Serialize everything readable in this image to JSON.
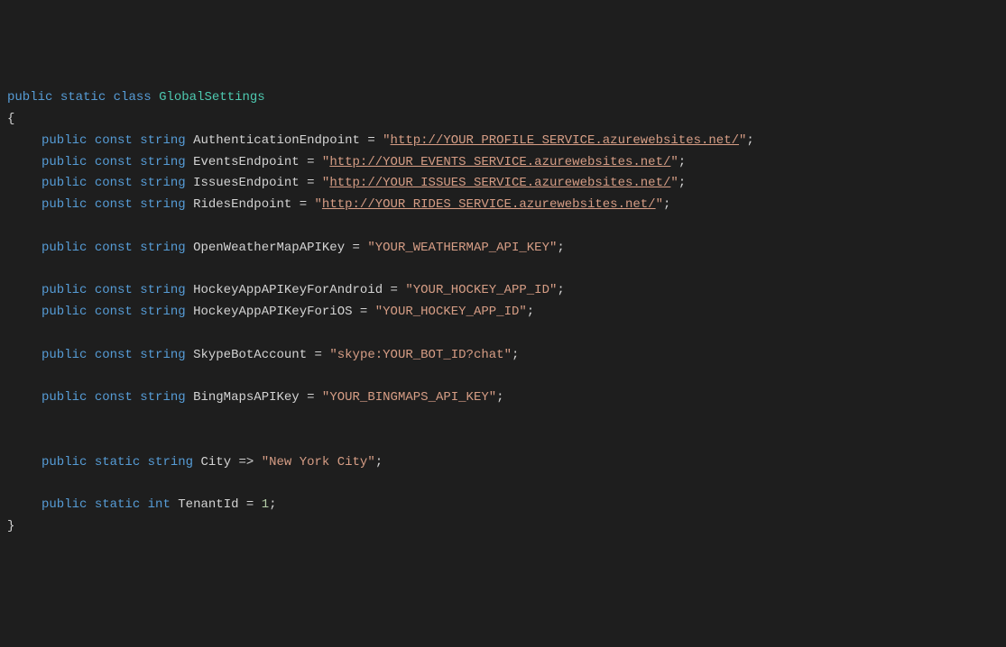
{
  "code": {
    "line0_public": "public",
    "line0_static": "static",
    "line0_class": "class",
    "line0_name": "GlobalSettings",
    "open_brace": "{",
    "close_brace": "}",
    "kw_public": "public",
    "kw_const": "const",
    "kw_static": "static",
    "kw_string": "string",
    "kw_int": "int",
    "eq": " = ",
    "arrow": " => ",
    "semi": ";",
    "quote": "\"",
    "auth_name": "AuthenticationEndpoint",
    "auth_url": "http://YOUR_PROFILE_SERVICE.azurewebsites.net/",
    "events_name": "EventsEndpoint",
    "events_url": "http://YOUR_EVENTS_SERVICE.azurewebsites.net/",
    "issues_name": "IssuesEndpoint",
    "issues_url": "http://YOUR_ISSUES_SERVICE.azurewebsites.net/",
    "rides_name": "RidesEndpoint",
    "rides_url": "http://YOUR_RIDES_SERVICE.azurewebsites.net/",
    "owm_name": "OpenWeatherMapAPIKey",
    "owm_val": "YOUR_WEATHERMAP_API_KEY",
    "hockey_android_name": "HockeyAppAPIKeyForAndroid",
    "hockey_android_val": "YOUR_HOCKEY_APP_ID",
    "hockey_ios_name": "HockeyAppAPIKeyForiOS",
    "hockey_ios_val": "YOUR_HOCKEY_APP_ID",
    "skype_name": "SkypeBotAccount",
    "skype_val": "skype:YOUR_BOT_ID?chat",
    "bing_name": "BingMapsAPIKey",
    "bing_val": "YOUR_BINGMAPS_API_KEY",
    "city_name": "City",
    "city_val": "New York City",
    "tenant_name": "TenantId",
    "tenant_val": "1"
  }
}
